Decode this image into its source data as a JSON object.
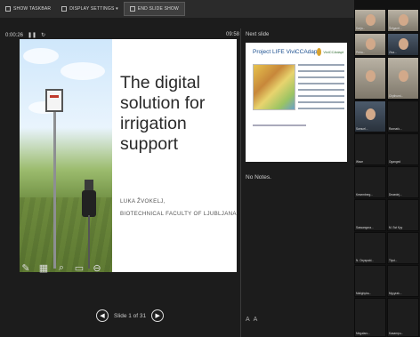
{
  "toolbar": {
    "taskbar_label": "SHOW TASKBAR",
    "display_settings_label": "DISPLAY SETTINGS ▾",
    "end_show_label": "END SLIDE SHOW"
  },
  "presenter": {
    "elapsed_time": "0:00:26",
    "clock": "09:58",
    "slide": {
      "title": "The digital solution for irrigation support",
      "author_name": "LUKA ŽVOKELJ,",
      "author_affiliation": "BIOTECHNICAL FACULTY OF LJUBLJANA"
    },
    "next_slide_label": "Next slide",
    "next_slide": {
      "title": "Project LIFE ViviCCAdapt",
      "logo_text": "ViviCCAdapt"
    },
    "notes_text": "No Notes.",
    "slide_counter": "Slide 1 of 31"
  },
  "gallery": {
    "tiles": [
      {
        "name": "Darja..."
      },
      {
        "name": "Šefgaref..."
      },
      {
        "name": "Petra..."
      },
      {
        "name": "Ziva..."
      },
      {
        "name": ""
      },
      {
        "name": "Chythumi..."
      },
      {
        "name": "Samuel..."
      },
      {
        "name": "Ravnaťo..."
      },
      {
        "name": "Wave"
      },
      {
        "name": "Oganged"
      },
      {
        "name": "Kesemberg..."
      },
      {
        "name": "Deaedej..."
      },
      {
        "name": "Sassangora..."
      },
      {
        "name": "M. Sst Kyy"
      },
      {
        "name": "N. Oxyspaid..."
      },
      {
        "name": "Tlyst..."
      },
      {
        "name": "Malighyba..."
      },
      {
        "name": "Myyyrak..."
      },
      {
        "name": "Megalaro..."
      },
      {
        "name": "Kasampu..."
      }
    ]
  }
}
